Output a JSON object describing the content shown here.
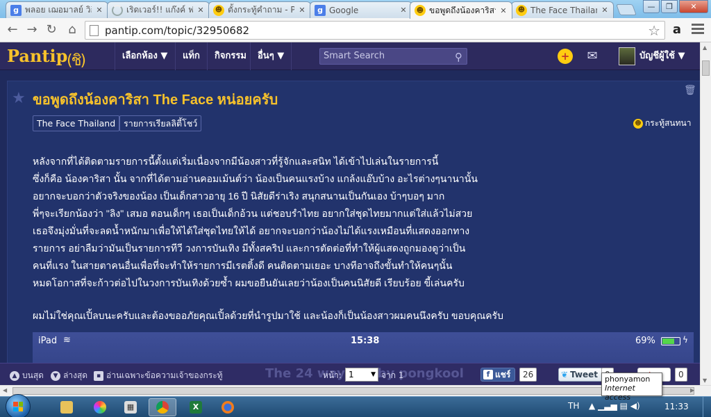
{
  "browser": {
    "tabs": [
      {
        "title": "พลอย เฌอมาลย์ วิกิ",
        "favicon": "g"
      },
      {
        "title": "เริดเวอร์!! แก๊งค์ ฟ",
        "favicon": "spin"
      },
      {
        "title": "ตั้งกระทู้คำถาม - Pa",
        "favicon": "smile"
      },
      {
        "title": "Google",
        "favicon": "g"
      },
      {
        "title": "ขอพูดถึงน้องคาริสา",
        "favicon": "smile"
      },
      {
        "title": "The Face Thailan",
        "favicon": "smile"
      }
    ],
    "active_tab": 4,
    "url": "pantip.com/topic/32950682",
    "window_buttons": {
      "minimize": "—",
      "maximize": "❐",
      "close": "✕"
    }
  },
  "site": {
    "logo": "Pantip",
    "logo_mark": "(ชิ)",
    "nav": [
      "เลือกห้อง ▼",
      "แท็ก",
      "กิจกรรม",
      "อื่นๆ ▼"
    ],
    "search_placeholder": "Smart Search",
    "account": "บัญชีผู้ใช้ ▼"
  },
  "topic": {
    "title": "ขอพูดถึงน้องคาริสา The Face หน่อยครับ",
    "tags": [
      "The Face Thailand",
      "รายการเรียลลิตี้โชว์"
    ],
    "type_label": "กระทู้สนทนา",
    "body_lines": [
      "หลังจากที่ได้ติดตามรายการนี้ตั้งแต่เริ่มเนื่องจากมีน้องสาวที่รู้จักและสนิท ได้เข้าไปเล่นในรายการนี้",
      "ซึ่งก็คือ น้องคาริสา นั้น จากที่ได้ตามอ่านคอมเม้นต์ว่า น้องเป็นคนแรงบ้าง แกล้งแอ๊บบ้าง  อะไรต่างๆนานานั้น",
      "อยากจะบอกว่าตัวจริงของน้อง เป็นเด็กสาวอายุ 16 ปี นิสัยดีร่าเริง สนุกสนานเป็นกันเอง บ้าๆบอๆ มาก",
      "พี่ๆจะเรียกน้องว่า \"ลิง\" เสมอ ตอนเด็กๆ เธอเป็นเด็กอ้วน แต่ชอบรำไทย อยากใส่ชุดไทยมากแต่ใส่แล้วไม่สวย",
      "เธอจึงมุ่งมั่นที่จะลดน้ำหนักมาเพื่อให้ได้ใส่ชุดไทยให้ได้  อยากจะบอกว่าน้องไม่ได้แรงเหมือนที่แสดงออกทาง",
      "รายการ อย่าลืมว่ามันเป็นรายการทีวี วงการบันเทิง มีทั้งสคริป และการตัดต่อที่ทำให้ผู้แสดงถูกมองดูว่าเป็น",
      "คนที่แรง ในสายตาคนอื่นเพื่อที่จะทำให้รายการมีเรตติ้งดี คนติดตามเยอะ บางทีอาจถึงขั้นทำให้คนๆนั้น",
      "หมดโอกาสที่จะก้าวต่อไปในวงการบันเทิงด้วยซ้ำ  ผมขอยืนยันเลยว่าน้องเป็นคนนิสัยดี เรียบร้อย ขี้เล่นครับ"
    ],
    "closing": "ผมไม่ใช่คุณเปิ้ลบนะครับและต้องขออภัยคุณเปิ้ลด้วยที่นำรูปมาใช้ และน้องก็เป็นน้องสาวผมคนนึงครับ ขอบคุณครับ"
  },
  "ipad_status": {
    "device": "iPad",
    "time": "15:38",
    "battery": "69%",
    "battery_level": 0.69
  },
  "bottom_bar": {
    "top": "บนสุด",
    "bottom": "ล่างสุด",
    "owner_only": "อ่านเฉพาะข้อความเจ้าของกระทู้",
    "ghost_text": "The 24 way but by pongkool",
    "page_label": "หน้า:",
    "page_value": "1",
    "page_of": "จาก 1",
    "fb_label": "แชร์",
    "fb_count": "26",
    "tw_label": "Tweet",
    "tw_count": "0",
    "gp_count": "0"
  },
  "tooltip": {
    "name": "phonyamon",
    "status": "Internet access"
  },
  "taskbar": {
    "lang": "TH",
    "time": "11:33"
  }
}
